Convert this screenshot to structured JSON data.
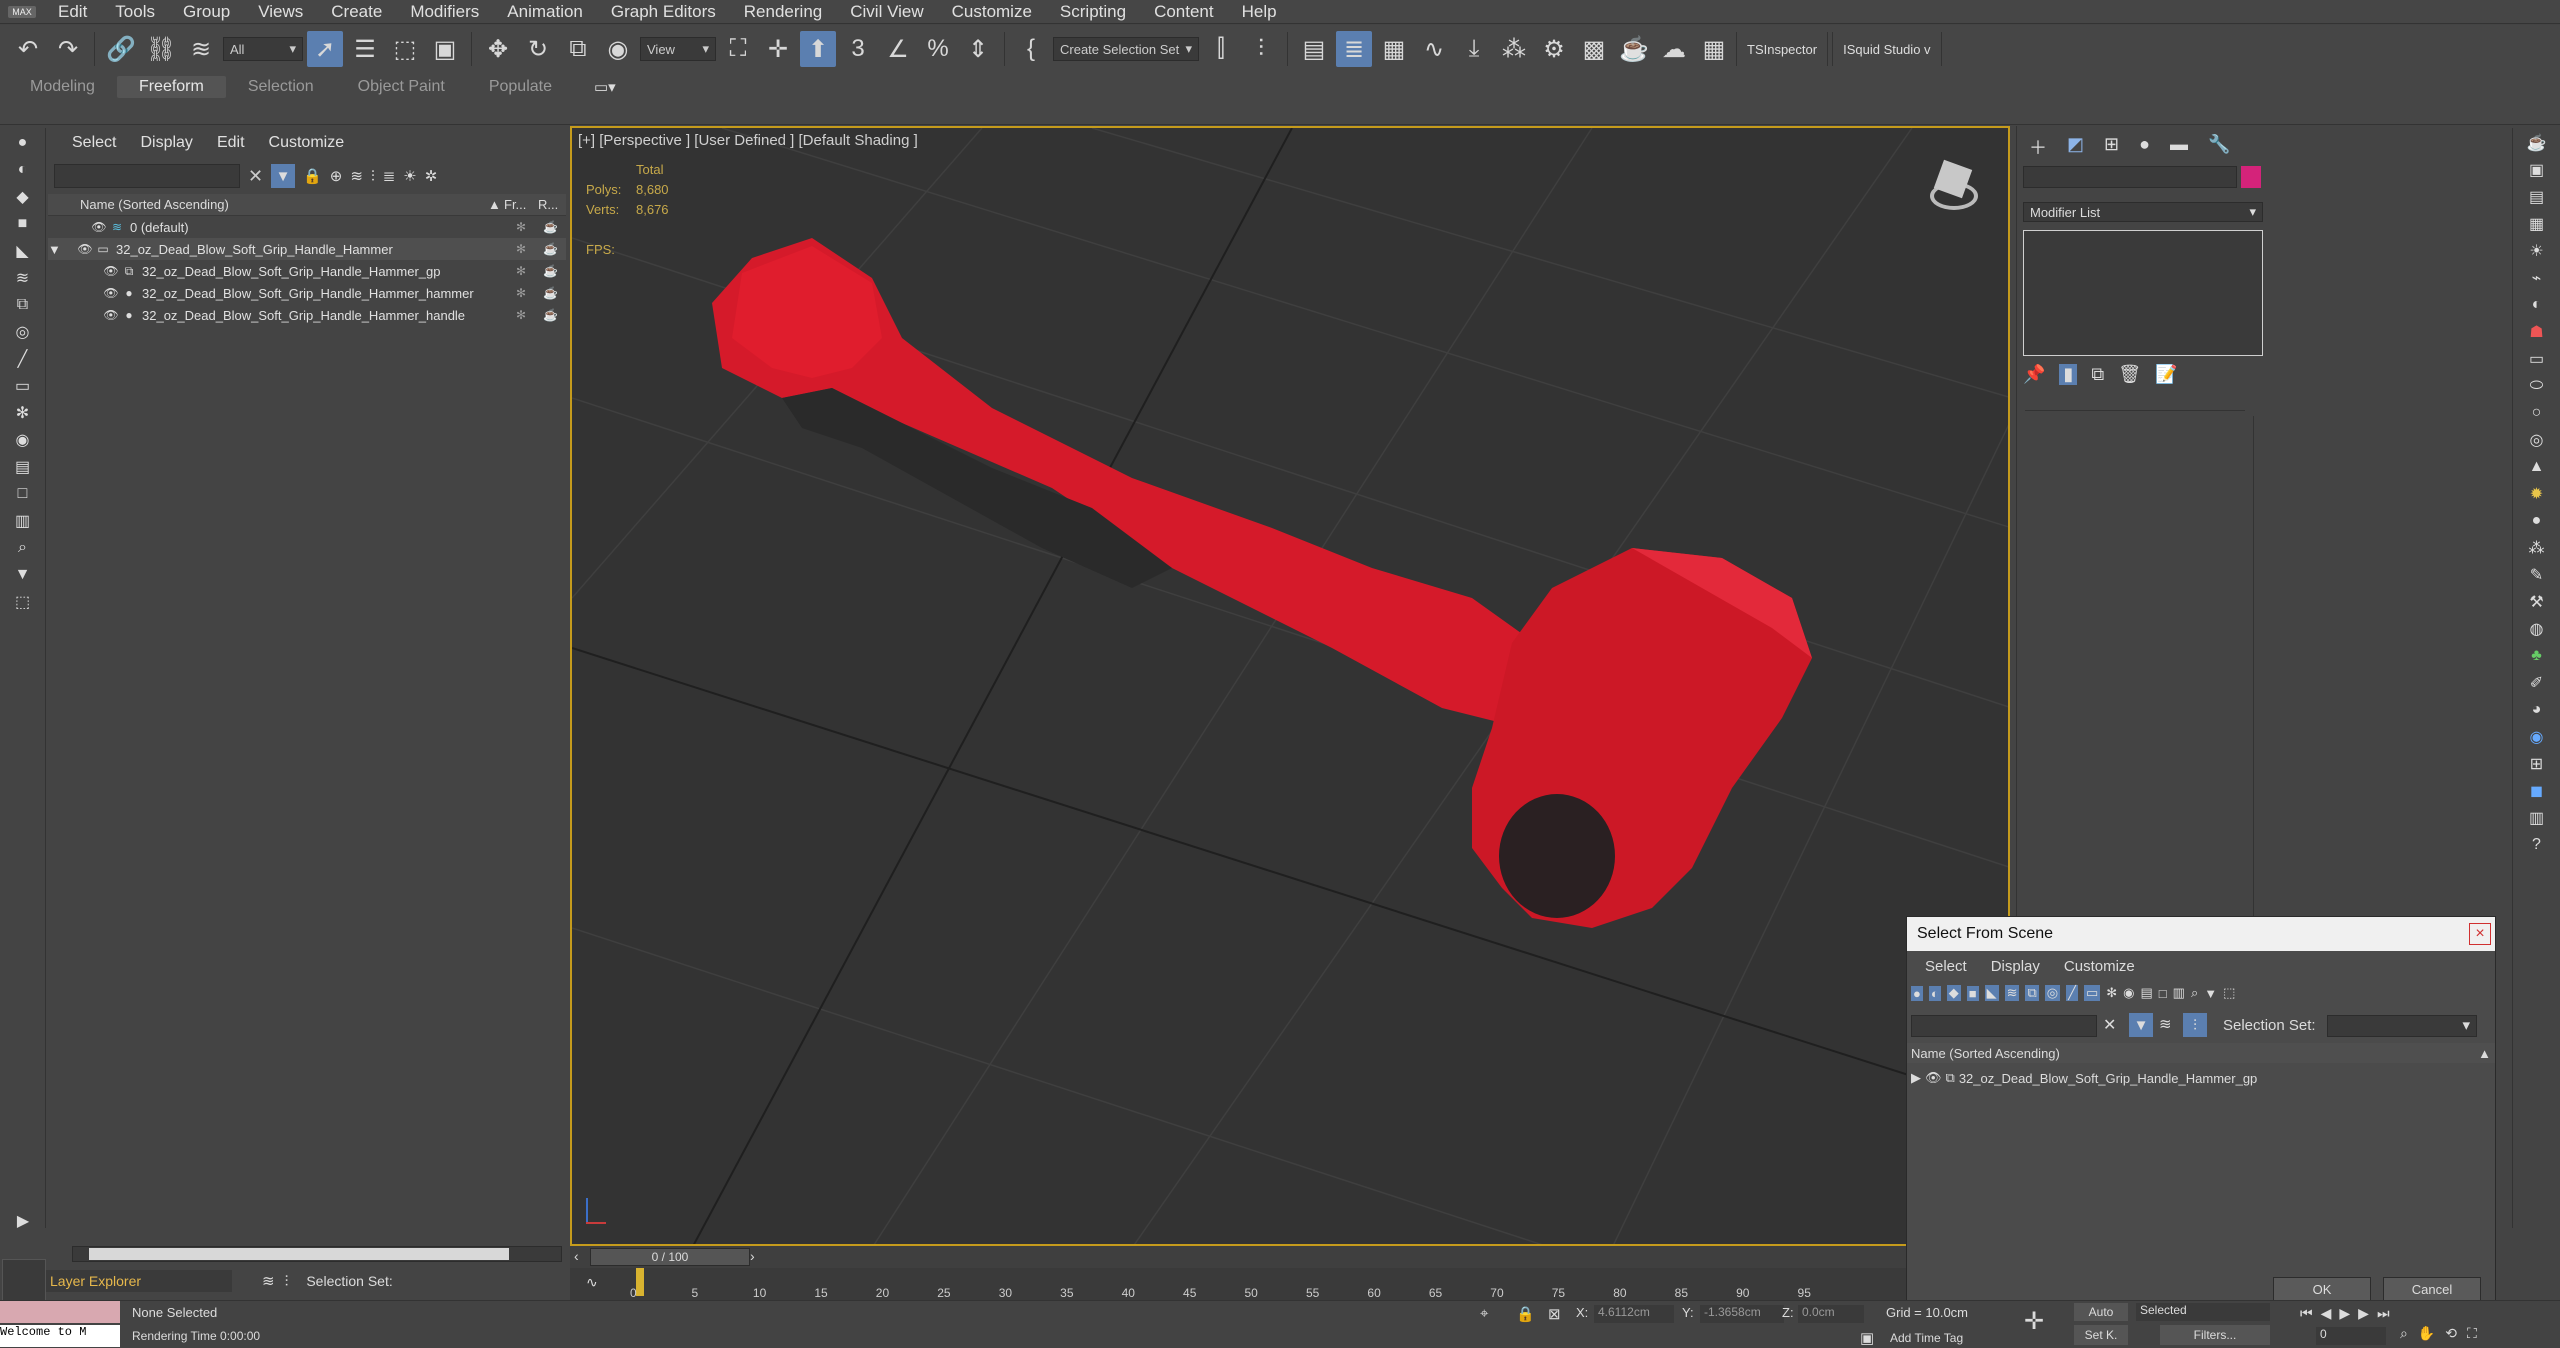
{
  "menu": [
    "Edit",
    "Tools",
    "Group",
    "Views",
    "Create",
    "Modifiers",
    "Animation",
    "Graph Editors",
    "Rendering",
    "Civil View",
    "Customize",
    "Scripting",
    "Content",
    "Help"
  ],
  "app_logo": "MAX",
  "toolbar": {
    "filter_value": "All",
    "refcoord_value": "View",
    "selection_set_placeholder": "Create Selection Set",
    "ts_inspector": "TSInspector",
    "isquid": "ISquid Studio v"
  },
  "ribbon_tabs": [
    "Modeling",
    "Freeform",
    "Selection",
    "Object Paint",
    "Populate"
  ],
  "scene_explorer": {
    "menu": [
      "Select",
      "Display",
      "Edit",
      "Customize"
    ],
    "col_name": "Name (Sorted Ascending)",
    "col_fr": "Fr...",
    "col_r": "R...",
    "rows": [
      {
        "label": "0 (default)",
        "indent": 0
      },
      {
        "label": "32_oz_Dead_Blow_Soft_Grip_Handle_Hammer",
        "indent": 0
      },
      {
        "label": "32_oz_Dead_Blow_Soft_Grip_Handle_Hammer_gp",
        "indent": 1
      },
      {
        "label": "32_oz_Dead_Blow_Soft_Grip_Handle_Hammer_hammer",
        "indent": 1
      },
      {
        "label": "32_oz_Dead_Blow_Soft_Grip_Handle_Hammer_handle",
        "indent": 1
      }
    ],
    "bottom_label": "Layer Explorer",
    "selection_set_label": "Selection Set:"
  },
  "viewport": {
    "label": "[+] [Perspective ] [User Defined ] [Default Shading ]",
    "stats_total": "Total",
    "polys_label": "Polys:",
    "polys_value": "8,680",
    "verts_label": "Verts:",
    "verts_value": "8,676",
    "fps_label": "FPS:"
  },
  "command_panel": {
    "modifier_list": "Modifier List",
    "swatch_color": "#d4237a"
  },
  "dialog": {
    "title": "Select From Scene",
    "close": "×",
    "menu": [
      "Select",
      "Display",
      "Customize"
    ],
    "selection_set_label": "Selection Set:",
    "col_name": "Name (Sorted Ascending)",
    "row": "32_oz_Dead_Blow_Soft_Grip_Handle_Hammer_gp",
    "ok": "OK",
    "cancel": "Cancel"
  },
  "timeline": {
    "frame_readout": "0 / 100",
    "ticks": [
      "0",
      "5",
      "10",
      "15",
      "20",
      "25",
      "30",
      "35",
      "40",
      "45",
      "50",
      "55",
      "60",
      "65",
      "70",
      "75",
      "80",
      "85",
      "90",
      "95"
    ]
  },
  "status": {
    "welcome": "Welcome to M",
    "none_selected": "None Selected",
    "rendering_time": "Rendering Time  0:00:00",
    "x_label": "X:",
    "x_value": "4.6112cm",
    "y_label": "Y:",
    "y_value": "-1.3658cm",
    "z_label": "Z:",
    "z_value": "0.0cm",
    "grid": "Grid = 10.0cm",
    "add_time_tag": "Add Time Tag",
    "auto": "Auto",
    "selected": "Selected",
    "set_key": "Set K.",
    "filters": "Filters...",
    "frame": "0"
  },
  "colors": {
    "hammer_red": "#d51a2a",
    "viewport_border": "#c59b1c",
    "stats": "#c7a94a"
  }
}
